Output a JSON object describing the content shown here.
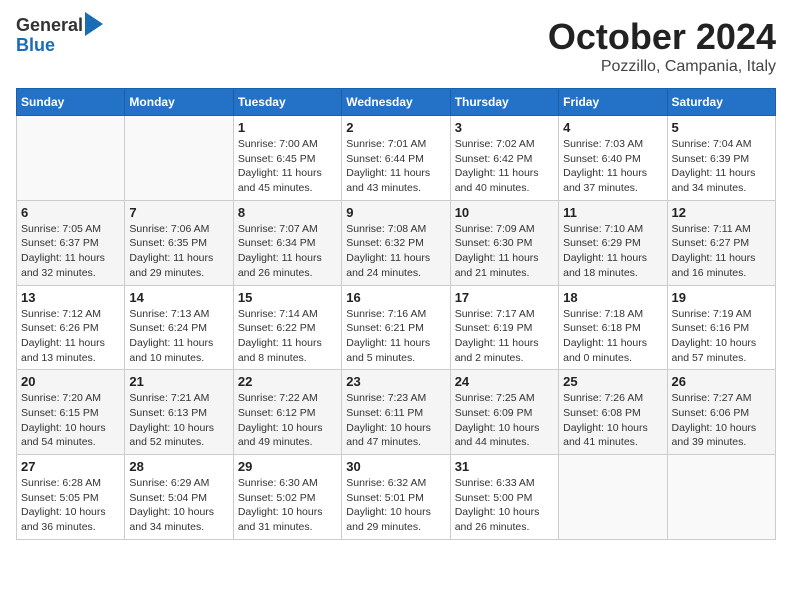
{
  "header": {
    "logo_line1": "General",
    "logo_line2": "Blue",
    "title": "October 2024",
    "subtitle": "Pozzillo, Campania, Italy"
  },
  "columns": [
    "Sunday",
    "Monday",
    "Tuesday",
    "Wednesday",
    "Thursday",
    "Friday",
    "Saturday"
  ],
  "rows": [
    [
      {
        "num": "",
        "detail": ""
      },
      {
        "num": "",
        "detail": ""
      },
      {
        "num": "1",
        "detail": "Sunrise: 7:00 AM\nSunset: 6:45 PM\nDaylight: 11 hours and 45 minutes."
      },
      {
        "num": "2",
        "detail": "Sunrise: 7:01 AM\nSunset: 6:44 PM\nDaylight: 11 hours and 43 minutes."
      },
      {
        "num": "3",
        "detail": "Sunrise: 7:02 AM\nSunset: 6:42 PM\nDaylight: 11 hours and 40 minutes."
      },
      {
        "num": "4",
        "detail": "Sunrise: 7:03 AM\nSunset: 6:40 PM\nDaylight: 11 hours and 37 minutes."
      },
      {
        "num": "5",
        "detail": "Sunrise: 7:04 AM\nSunset: 6:39 PM\nDaylight: 11 hours and 34 minutes."
      }
    ],
    [
      {
        "num": "6",
        "detail": "Sunrise: 7:05 AM\nSunset: 6:37 PM\nDaylight: 11 hours and 32 minutes."
      },
      {
        "num": "7",
        "detail": "Sunrise: 7:06 AM\nSunset: 6:35 PM\nDaylight: 11 hours and 29 minutes."
      },
      {
        "num": "8",
        "detail": "Sunrise: 7:07 AM\nSunset: 6:34 PM\nDaylight: 11 hours and 26 minutes."
      },
      {
        "num": "9",
        "detail": "Sunrise: 7:08 AM\nSunset: 6:32 PM\nDaylight: 11 hours and 24 minutes."
      },
      {
        "num": "10",
        "detail": "Sunrise: 7:09 AM\nSunset: 6:30 PM\nDaylight: 11 hours and 21 minutes."
      },
      {
        "num": "11",
        "detail": "Sunrise: 7:10 AM\nSunset: 6:29 PM\nDaylight: 11 hours and 18 minutes."
      },
      {
        "num": "12",
        "detail": "Sunrise: 7:11 AM\nSunset: 6:27 PM\nDaylight: 11 hours and 16 minutes."
      }
    ],
    [
      {
        "num": "13",
        "detail": "Sunrise: 7:12 AM\nSunset: 6:26 PM\nDaylight: 11 hours and 13 minutes."
      },
      {
        "num": "14",
        "detail": "Sunrise: 7:13 AM\nSunset: 6:24 PM\nDaylight: 11 hours and 10 minutes."
      },
      {
        "num": "15",
        "detail": "Sunrise: 7:14 AM\nSunset: 6:22 PM\nDaylight: 11 hours and 8 minutes."
      },
      {
        "num": "16",
        "detail": "Sunrise: 7:16 AM\nSunset: 6:21 PM\nDaylight: 11 hours and 5 minutes."
      },
      {
        "num": "17",
        "detail": "Sunrise: 7:17 AM\nSunset: 6:19 PM\nDaylight: 11 hours and 2 minutes."
      },
      {
        "num": "18",
        "detail": "Sunrise: 7:18 AM\nSunset: 6:18 PM\nDaylight: 11 hours and 0 minutes."
      },
      {
        "num": "19",
        "detail": "Sunrise: 7:19 AM\nSunset: 6:16 PM\nDaylight: 10 hours and 57 minutes."
      }
    ],
    [
      {
        "num": "20",
        "detail": "Sunrise: 7:20 AM\nSunset: 6:15 PM\nDaylight: 10 hours and 54 minutes."
      },
      {
        "num": "21",
        "detail": "Sunrise: 7:21 AM\nSunset: 6:13 PM\nDaylight: 10 hours and 52 minutes."
      },
      {
        "num": "22",
        "detail": "Sunrise: 7:22 AM\nSunset: 6:12 PM\nDaylight: 10 hours and 49 minutes."
      },
      {
        "num": "23",
        "detail": "Sunrise: 7:23 AM\nSunset: 6:11 PM\nDaylight: 10 hours and 47 minutes."
      },
      {
        "num": "24",
        "detail": "Sunrise: 7:25 AM\nSunset: 6:09 PM\nDaylight: 10 hours and 44 minutes."
      },
      {
        "num": "25",
        "detail": "Sunrise: 7:26 AM\nSunset: 6:08 PM\nDaylight: 10 hours and 41 minutes."
      },
      {
        "num": "26",
        "detail": "Sunrise: 7:27 AM\nSunset: 6:06 PM\nDaylight: 10 hours and 39 minutes."
      }
    ],
    [
      {
        "num": "27",
        "detail": "Sunrise: 6:28 AM\nSunset: 5:05 PM\nDaylight: 10 hours and 36 minutes."
      },
      {
        "num": "28",
        "detail": "Sunrise: 6:29 AM\nSunset: 5:04 PM\nDaylight: 10 hours and 34 minutes."
      },
      {
        "num": "29",
        "detail": "Sunrise: 6:30 AM\nSunset: 5:02 PM\nDaylight: 10 hours and 31 minutes."
      },
      {
        "num": "30",
        "detail": "Sunrise: 6:32 AM\nSunset: 5:01 PM\nDaylight: 10 hours and 29 minutes."
      },
      {
        "num": "31",
        "detail": "Sunrise: 6:33 AM\nSunset: 5:00 PM\nDaylight: 10 hours and 26 minutes."
      },
      {
        "num": "",
        "detail": ""
      },
      {
        "num": "",
        "detail": ""
      }
    ]
  ]
}
